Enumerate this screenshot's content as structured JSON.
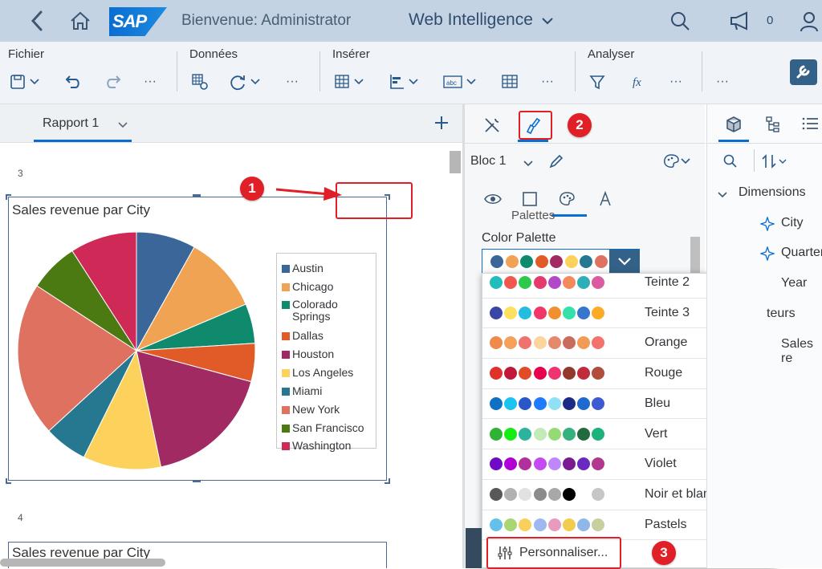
{
  "shell": {
    "welcome": "Bienvenue: Administrator",
    "app_title": "Web Intelligence",
    "notification_count": "0",
    "logo_text": "SAP"
  },
  "toolbar": {
    "groups": [
      "Fichier",
      "Données",
      "Insérer",
      "Analyser"
    ],
    "more": "···"
  },
  "report": {
    "tab_label": "Rapport 1",
    "block1_number": "3",
    "block2_number": "4",
    "chart_title": "Sales revenue par City",
    "chart2_title": "Sales revenue par City"
  },
  "chart_data": {
    "type": "pie",
    "title": "Sales revenue par City",
    "categories": [
      "Austin",
      "Chicago",
      "Colorado Springs",
      "Dallas",
      "Houston",
      "Los Angeles",
      "Miami",
      "New York",
      "San Francisco",
      "Washington"
    ],
    "values": [
      8.1,
      10.5,
      5.4,
      5.2,
      17.5,
      10.6,
      5.9,
      21.0,
      6.7,
      9.1
    ],
    "colors": [
      "#3a6699",
      "#efa353",
      "#0f8a6c",
      "#e05b28",
      "#a12a62",
      "#fcd15c",
      "#267891",
      "#df7161",
      "#4c7a12",
      "#cf2957"
    ],
    "legend_position": "right"
  },
  "format_panel": {
    "block_label": "Bloc 1",
    "section_partial": "Palettes",
    "palette_label": "Color Palette",
    "current_palette": [
      "#3a6699",
      "#efa353",
      "#0f8a6c",
      "#e05b28",
      "#a12a62",
      "#fcd15c",
      "#267891",
      "#df7161"
    ],
    "palettes": [
      {
        "label": "Teinte 2",
        "colors": [
          "#21bdbd",
          "#f0584f",
          "#2ec84c",
          "#e63a6c",
          "#b249c6",
          "#f48a5b",
          "#2eaeb6",
          "#dc5aa0"
        ]
      },
      {
        "label": "Teinte 3",
        "colors": [
          "#3946a8",
          "#fbe15e",
          "#24bde0",
          "#f1376a",
          "#f18f31",
          "#35e0a9",
          "#3676cc",
          "#fbab25"
        ]
      },
      {
        "label": "Orange",
        "colors": [
          "#f08a4b",
          "#f6a15a",
          "#f0726f",
          "#fcd49d",
          "#e6896a",
          "#c96c5d",
          "#f19b55",
          "#f2726c"
        ]
      },
      {
        "label": "Rouge",
        "colors": [
          "#e0322d",
          "#c0193c",
          "#e14c28",
          "#e8004f",
          "#f0346e",
          "#93382c",
          "#c12b3c",
          "#b24d3c"
        ]
      },
      {
        "label": "Bleu",
        "colors": [
          "#0e71c4",
          "#1bc3f1",
          "#2a57c7",
          "#1f7aff",
          "#90e1f6",
          "#1b2c86",
          "#1e6ad1",
          "#3d5ad2"
        ]
      },
      {
        "label": "Vert",
        "colors": [
          "#2fb335",
          "#19ec15",
          "#2bb39e",
          "#c3eab9",
          "#95da74",
          "#35b17d",
          "#226b3e",
          "#1bb27c"
        ]
      },
      {
        "label": "Violet",
        "colors": [
          "#6f0ac6",
          "#b000d6",
          "#b2309a",
          "#c34bf1",
          "#be87fb",
          "#791c91",
          "#6b29c3",
          "#b3378e"
        ]
      },
      {
        "label": "Noir et blanc",
        "colors": [
          "#585858",
          "#b1b1b1",
          "#e1e1e1",
          "#8b8b8b",
          "#a8a8a8",
          "#000000",
          "#ffffff",
          "#c6c6c6"
        ]
      },
      {
        "label": "Pastels",
        "colors": [
          "#65c1ec",
          "#a9d573",
          "#fad05c",
          "#9fb8ed",
          "#e99bbd",
          "#f2cd4c",
          "#8fb7e8",
          "#c7cf9e"
        ]
      }
    ],
    "customize_label": "Personnaliser..."
  },
  "data_panel": {
    "dimensions_label": "Dimensions",
    "items": [
      "City",
      "Quarter",
      "Year"
    ],
    "indicators_partial": "teurs",
    "sales_partial": "Sales re"
  },
  "annotations": [
    "1",
    "2",
    "3"
  ]
}
